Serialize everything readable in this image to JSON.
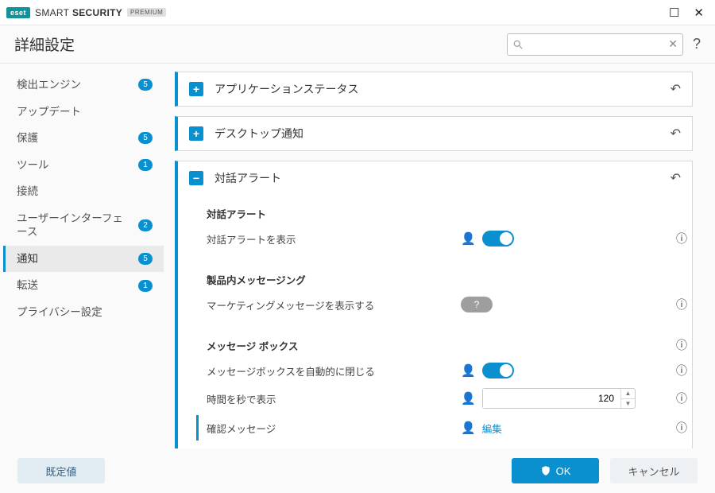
{
  "brand": {
    "logo": "eset",
    "text_light": "SMART",
    "text_bold": "SECURITY",
    "badge": "PREMIUM"
  },
  "window": {
    "maximize": "☐",
    "close": "✕"
  },
  "header": {
    "title": "詳細設定",
    "search_placeholder": "",
    "help": "?"
  },
  "sidebar": [
    {
      "id": "detect",
      "label": "検出エンジン",
      "badge": "5",
      "active": false
    },
    {
      "id": "update",
      "label": "アップデート",
      "badge": null,
      "active": false
    },
    {
      "id": "protect",
      "label": "保護",
      "badge": "5",
      "active": false
    },
    {
      "id": "tools",
      "label": "ツール",
      "badge": "1",
      "active": false
    },
    {
      "id": "connect",
      "label": "接続",
      "badge": null,
      "active": false
    },
    {
      "id": "ui",
      "label": "ユーザーインターフェース",
      "badge": "2",
      "active": false
    },
    {
      "id": "notify",
      "label": "通知",
      "badge": "5",
      "active": true
    },
    {
      "id": "forward",
      "label": "転送",
      "badge": "1",
      "active": false
    },
    {
      "id": "privacy",
      "label": "プライバシー設定",
      "badge": null,
      "active": false
    }
  ],
  "panels": {
    "app_status": {
      "title": "アプリケーションステータス"
    },
    "desktop": {
      "title": "デスクトップ通知"
    },
    "alert": {
      "title": "対話アラート"
    }
  },
  "alert": {
    "h1": "対話アラート",
    "show_alerts": "対話アラートを表示",
    "h2": "製品内メッセージング",
    "marketing": "マーケティングメッセージを表示する",
    "h3": "メッセージ ボックス",
    "autoclose": "メッセージボックスを自動的に閉じる",
    "seconds_label": "時間を秒で表示",
    "seconds_value": "120",
    "confirm_label": "確認メッセージ",
    "confirm_link": "編集"
  },
  "footer": {
    "default": "既定値",
    "ok": "OK",
    "cancel": "キャンセル"
  }
}
